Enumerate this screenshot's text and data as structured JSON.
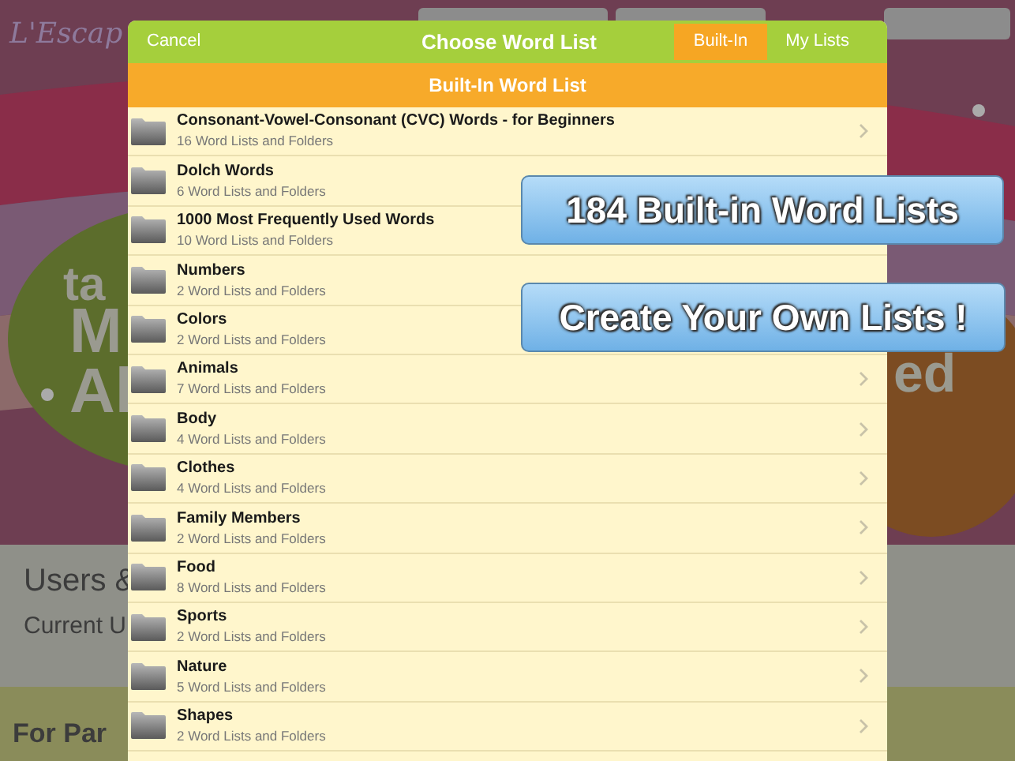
{
  "background": {
    "logo": "L'Escap",
    "title_fragments": [
      "ta",
      "M",
      "Al"
    ],
    "right_fragment": "ed",
    "section_title": "Users &",
    "current_user": "Current U",
    "footer": "For Par"
  },
  "nav": {
    "cancel": "Cancel",
    "title": "Choose Word List",
    "segments": [
      {
        "label": "Built-In",
        "selected": true
      },
      {
        "label": "My Lists",
        "selected": false
      }
    ]
  },
  "header": "Built-In Word List",
  "items": [
    {
      "title": "Consonant-Vowel-Consonant (CVC) Words - for Beginners",
      "subtitle": "16 Word Lists and Folders",
      "chevron": true
    },
    {
      "title": "Dolch Words",
      "subtitle": "6 Word Lists and Folders",
      "chevron": false
    },
    {
      "title": "1000 Most Frequently Used Words",
      "subtitle": "10 Word Lists and Folders",
      "chevron": false
    },
    {
      "title": "Numbers",
      "subtitle": "2 Word Lists and Folders",
      "chevron": false
    },
    {
      "title": "Colors",
      "subtitle": "2 Word Lists and Folders",
      "chevron": false
    },
    {
      "title": "Animals",
      "subtitle": "7 Word Lists and Folders",
      "chevron": true
    },
    {
      "title": "Body",
      "subtitle": "4 Word Lists and Folders",
      "chevron": true
    },
    {
      "title": "Clothes",
      "subtitle": "4 Word Lists and Folders",
      "chevron": true
    },
    {
      "title": "Family Members",
      "subtitle": "2 Word Lists and Folders",
      "chevron": true
    },
    {
      "title": "Food",
      "subtitle": "8 Word Lists and Folders",
      "chevron": true
    },
    {
      "title": "Sports",
      "subtitle": "2 Word Lists and Folders",
      "chevron": true
    },
    {
      "title": "Nature",
      "subtitle": "5 Word Lists and Folders",
      "chevron": true
    },
    {
      "title": "Shapes",
      "subtitle": "2 Word Lists and Folders",
      "chevron": true
    }
  ],
  "callouts": [
    "184 Built-in Word Lists",
    "Create Your Own Lists !"
  ]
}
